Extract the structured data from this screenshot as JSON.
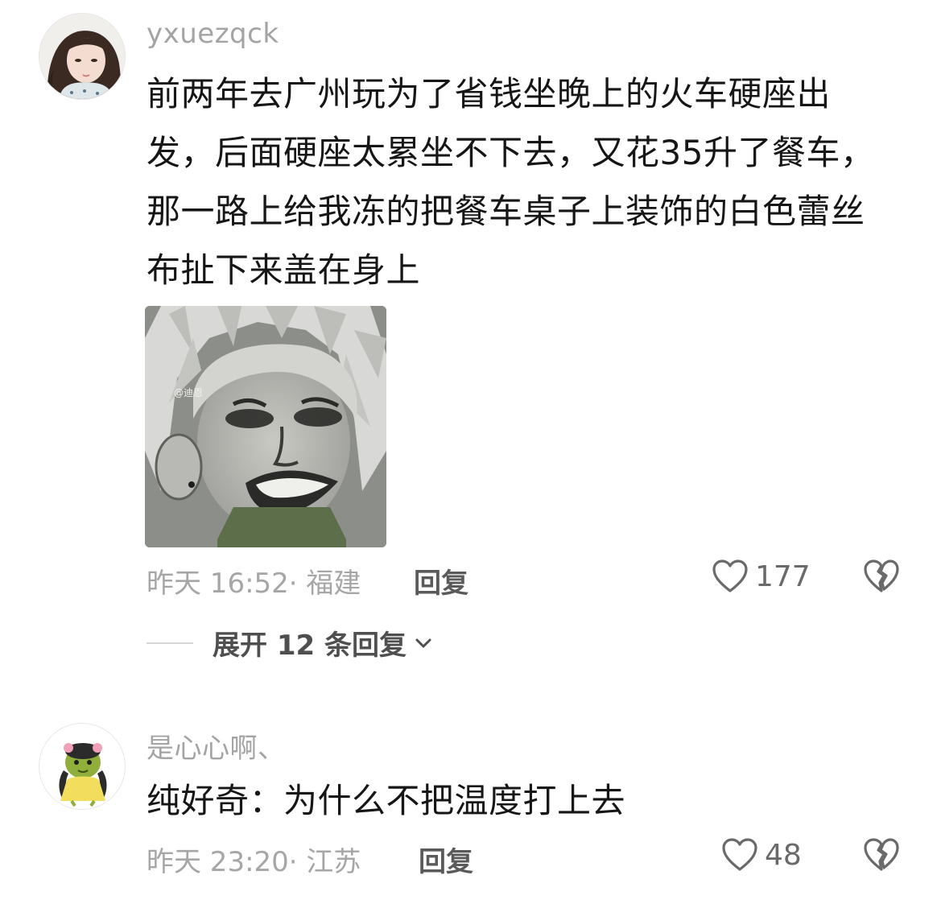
{
  "comments": [
    {
      "username": "yxuezqck",
      "lines": [
        "前两年去广州玩为了省钱坐晚上的火车硬座出",
        "发，后面硬座太累坐不下去，又花35升了餐车，",
        "那一路上给我冻的把餐车桌子上装饰的白色蕾丝",
        "布扯下来盖在身上"
      ],
      "image_watermark": "@迪恩",
      "meta": "昨天 16:52· 福建",
      "reply_label": "回复",
      "like_count": "177",
      "expand_label": "展开 12 条回复"
    },
    {
      "username": "是心心啊、",
      "text": "纯好奇：为什么不把温度打上去",
      "meta": "昨天 23:20· 江苏",
      "reply_label": "回复",
      "like_count": "48"
    }
  ],
  "icons": {
    "like": "heart-outline-icon",
    "dislike": "broken-heart-icon",
    "expand": "chevron-down-icon"
  },
  "colors": {
    "secondary_text": "#a6a6a6",
    "primary_text": "#161616",
    "icon_stroke": "#6a6a6a"
  }
}
